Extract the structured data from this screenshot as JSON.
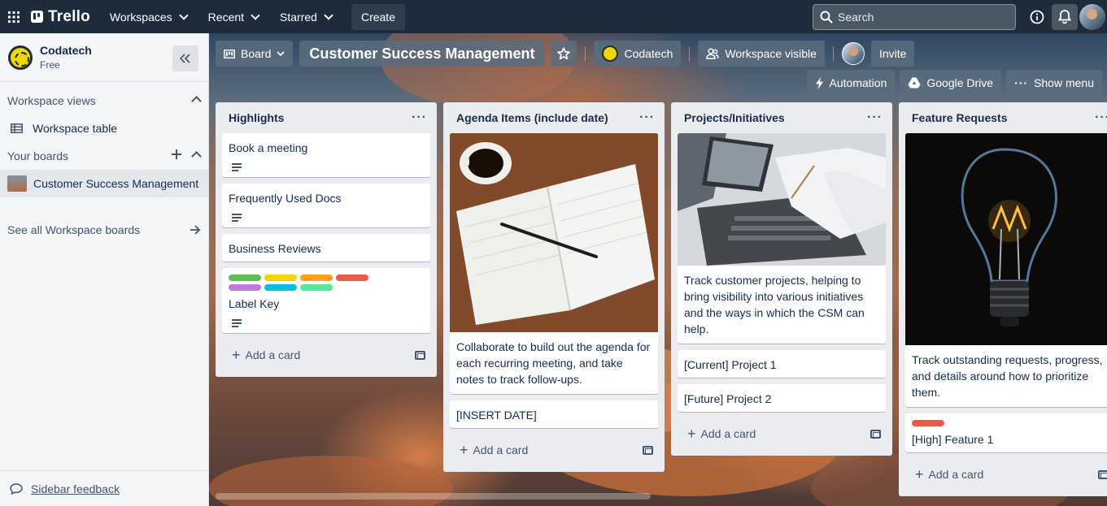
{
  "topnav": {
    "logo": "Trello",
    "menus": [
      "Workspaces",
      "Recent",
      "Starred"
    ],
    "create": "Create",
    "search_placeholder": "Search"
  },
  "sidebar": {
    "workspace_name": "Codatech",
    "workspace_plan": "Free",
    "workspace_views_label": "Workspace views",
    "workspace_table": "Workspace table",
    "your_boards_label": "Your boards",
    "board_item": "Customer Success Management",
    "see_all": "See all Workspace boards",
    "feedback": "Sidebar feedback"
  },
  "boardbar": {
    "view": "Board",
    "title": "Customer Success Management",
    "workspace": "Codatech",
    "visibility": "Workspace visible",
    "invite": "Invite",
    "automation": "Automation",
    "google_drive": "Google Drive",
    "show_menu": "Show menu"
  },
  "add_card_label": "Add a card",
  "colors": {
    "nav_bg": "#1d2b3a",
    "label_colors": [
      "#61bd4f",
      "#f2d600",
      "#ff9f1a",
      "#eb5a46",
      "#c377e0",
      "#00c2e0",
      "#51e898"
    ],
    "high_label": "#eb5a46"
  },
  "lists": [
    {
      "title": "Highlights",
      "cards": [
        {
          "title": "Book a meeting"
        },
        {
          "title": "Frequently Used Docs"
        },
        {
          "title": "Business Reviews"
        },
        {
          "title": "Label Key"
        }
      ]
    },
    {
      "title": "Agenda Items (include date)",
      "cover_desc": "Collaborate to build out the agenda for each recurring meeting, and take notes to track follow-ups.",
      "cards": [
        {
          "title": "[INSERT DATE]"
        }
      ]
    },
    {
      "title": "Projects/Initiatives",
      "cover_desc": "Track customer projects, helping to bring visibility into various initiatives and the ways in which the CSM can help.",
      "cards": [
        {
          "title": "[Current] Project 1"
        },
        {
          "title": "[Future] Project 2"
        }
      ]
    },
    {
      "title": "Feature Requests",
      "cover_desc": "Track outstanding requests, progress, and details around how to prioritize them.",
      "cards": [
        {
          "title": "[High] Feature 1"
        }
      ]
    }
  ]
}
